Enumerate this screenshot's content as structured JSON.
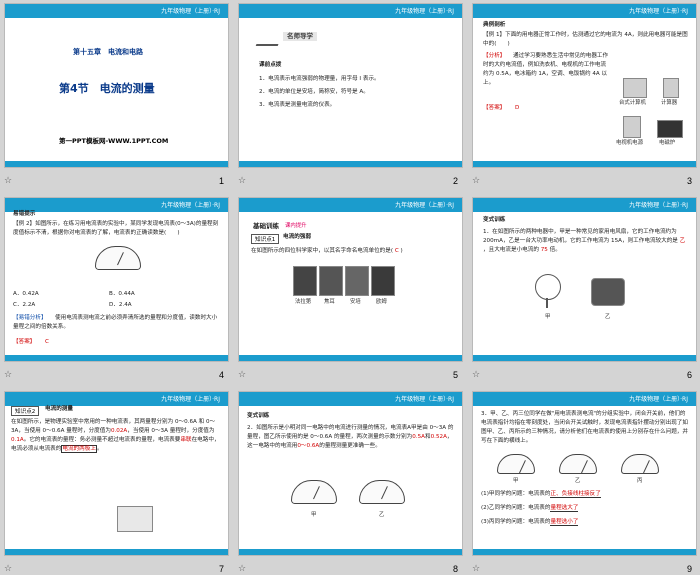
{
  "header_title": "九年级物理（上册）·RJ",
  "star_glyph": "☆",
  "slides": {
    "s1": {
      "number": "1",
      "chapter": "第十五章　电流和电路",
      "title": "第4节　电流的测量",
      "footer": "第一PPT模板网-WWW.1PPT.COM"
    },
    "s2": {
      "number": "2",
      "banner": "名师导学",
      "subtitle": "课前点拨",
      "items": [
        "1．电流表示电流强弱的物理量，用字母 I 表示。",
        "2．电流的单位是安培，简称安，符号是 A。",
        "3．电流表是测量电流的仪表。"
      ]
    },
    "s3": {
      "number": "3",
      "head": "典例剖析",
      "q": "【例 1】下面的用电器正常工作时，估测通过它的电流为 4A，则此用电器可能是图中的(　　)",
      "analysis_tag": "【分析】",
      "analysis": "通过学习要熟悉生活中常见的电器工作时的大约电流值，例如洗衣机、电视机的工作电流约为 0.5A，电冰箱约 1A，空调、电饭锅约 4A 以上。",
      "answer_tag": "【答案】",
      "answer": "D",
      "items": [
        "台式计算机",
        "计算器",
        "电视机电源",
        "电磁炉"
      ]
    },
    "s4": {
      "number": "4",
      "head": "易错提示",
      "q": "【例 2】如图所示，在练习用电流表的实验中，某同学发现电流表(0～3A)的量程刻度值标示不清，根据你对电流表的了解，电流表的正确读数是(　　)",
      "options": [
        "A．0.42A",
        "B．0.44A",
        "C．2.2A",
        "D．2.4A"
      ],
      "tip_tag": "【易错分析】",
      "tip": "使用电流表测电流之前必须弄清所选的量程和分度值，读数时大小量程之间的倍数关系。",
      "answer_tag": "【答案】",
      "answer": "C"
    },
    "s5": {
      "number": "5",
      "banner": "基础训练",
      "banner2": "课内提升",
      "knowledge": "知识点1",
      "knowledge_title": "电流的强弱",
      "q": "在如图所示的四位科学家中，以其名字命名电流单位的是(",
      "answer": "C",
      "q_end": ")",
      "people": [
        "法拉第",
        "焦耳",
        "安培",
        "欧姆"
      ]
    },
    "s6": {
      "number": "6",
      "head": "变式训练",
      "q": "1．在如图所示的两种电器中，甲是一种常见的家用电风扇，它的工作电流约为 200mA，乙是一台大功率电动机，它的工作电流为 15A，则工作电流较大的是",
      "ans1": "乙",
      "mid": "，且大电流是小电流的",
      "ans2": "75",
      "tail": "倍。",
      "labels": [
        "甲",
        "乙"
      ]
    },
    "s7": {
      "number": "7",
      "knowledge": "知识点2",
      "knowledge_title": "电流的测量",
      "text": "在如图所示，是物理实验室中常用的一种电流表，其两量程分别为 0～0.6A 和 0～3A，当使用 0～0.6A 量程时，分度值为",
      "a1": "0.02A",
      "text2": "，当使用 0～3A 量程时，分度值为",
      "a2": "0.1A",
      "text3": "。它的电流表的量程：务必测量不超过电流表的量程，电流表要",
      "a3": "串联",
      "text4": "在电路中，电流必须从电流表的",
      "a4": "电流的两极上",
      "text5": "。"
    },
    "s8": {
      "number": "8",
      "head": "变式训练",
      "q": "2．如图所示是小明对同一电路中的电流进行测量的情况，电流表A甲是由 0～3A 的量程，图乙所示使用的是 0～0.6A 的量程，两次测量的示数分别为",
      "a1": "0.5A",
      "mid": "和",
      "a2": "0.52A",
      "tail": "，这一电路中的电流用",
      "a3": "0～0.6A",
      "tail2": "的量程测量更准确一些。",
      "labels": [
        "甲",
        "乙"
      ]
    },
    "s9": {
      "number": "9",
      "q": "3．甲、乙、丙三位同学在做\"用电流表测电流\"的分组实验中，闭合开关前，他们的电流表指针均指在零刻度处，当闭合开关试触时，发现电流表指针摆动分别出现了如图甲、乙、丙所示的三种情况，请分析他们在电流表的使用上分别存在什么问题，并写在下面的横线上。",
      "labels": [
        "甲",
        "乙",
        "丙"
      ],
      "lines": [
        {
          "k": "(1)甲同学的问题：电流表的",
          "v": "正、负接线柱接反了"
        },
        {
          "k": "(2)乙同学的问题：电流表的",
          "v": "量程选大了"
        },
        {
          "k": "(3)丙同学的问题：电流表的",
          "v": "量程选小了"
        }
      ]
    }
  }
}
